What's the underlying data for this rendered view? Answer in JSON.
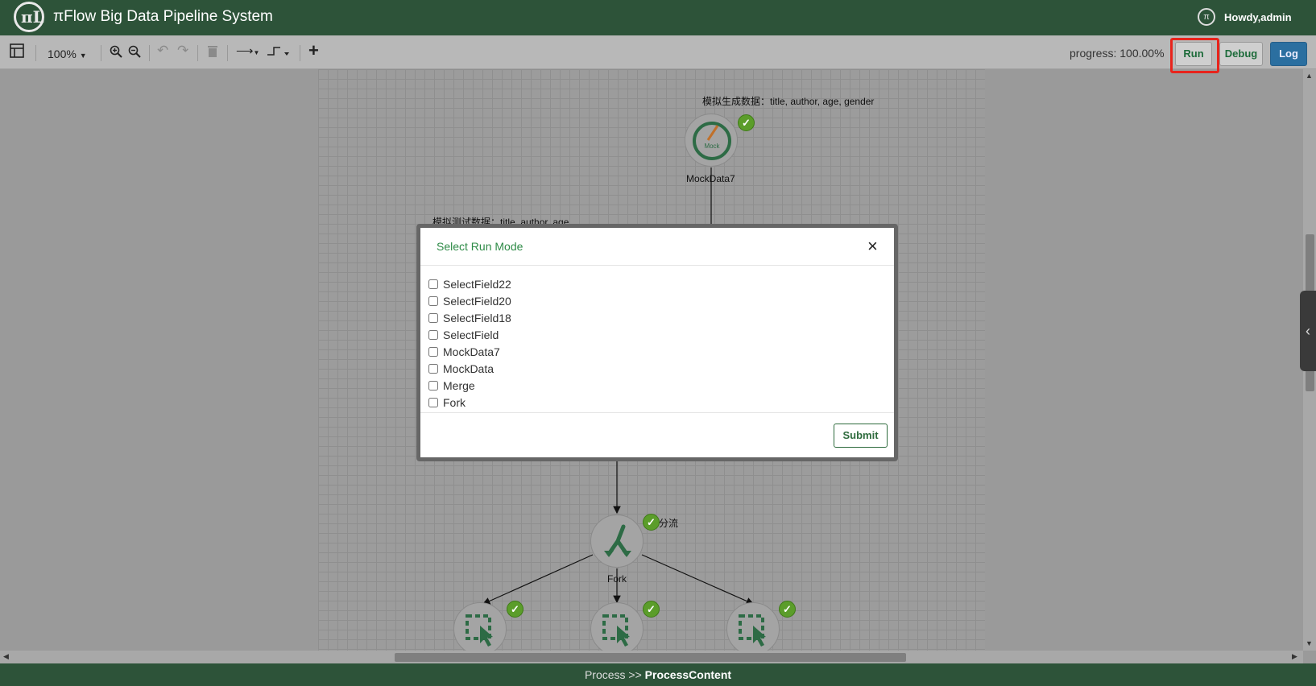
{
  "header": {
    "app_title": "πFlow Big Data Pipeline System",
    "greeting": "Howdy,admin",
    "logo_text": "πL"
  },
  "toolbar": {
    "zoom_level": "100%",
    "progress_label": "progress:",
    "progress_value": "100.00%",
    "run_label": "Run",
    "debug_label": "Debug",
    "log_label": "Log",
    "add_symbol": "+"
  },
  "canvas": {
    "nodes": {
      "mockdata7": {
        "label": "MockData7",
        "desc": "模拟生成数据：title, author, age, gender",
        "icon_text": "Mock"
      },
      "mockdata": {
        "desc": "模拟测试数据：title, author, age"
      },
      "fork": {
        "label": "Fork",
        "desc": "分流"
      }
    }
  },
  "modal": {
    "title": "Select Run Mode",
    "close_symbol": "×",
    "options": [
      "SelectField22",
      "SelectField20",
      "SelectField18",
      "SelectField",
      "MockData7",
      "MockData",
      "Merge",
      "Fork"
    ],
    "submit_label": "Submit"
  },
  "footer": {
    "prefix": "Process >>",
    "current": "ProcessContent"
  },
  "colors": {
    "brand_green": "#2d5339",
    "success_green": "#5b9d2a",
    "highlight_red": "#e8241c",
    "log_blue": "#2b6fa0"
  }
}
